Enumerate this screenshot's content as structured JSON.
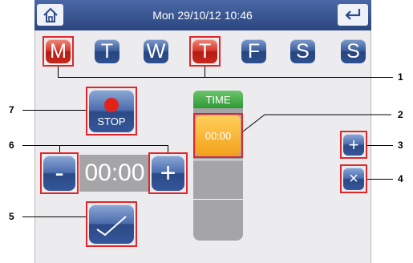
{
  "header": {
    "datetime": "Mon 29/10/12 10:46",
    "home_icon": "home-icon",
    "back_icon": "return-arrow-icon"
  },
  "days": [
    {
      "label": "M",
      "active": true
    },
    {
      "label": "T",
      "active": false
    },
    {
      "label": "W",
      "active": false
    },
    {
      "label": "T",
      "active": true
    },
    {
      "label": "F",
      "active": false
    },
    {
      "label": "S",
      "active": false
    },
    {
      "label": "S",
      "active": false
    }
  ],
  "stop_button": {
    "label": "STOP"
  },
  "time_column": {
    "header": "TIME",
    "slot_value": "00:00"
  },
  "time_adjust": {
    "minus": "-",
    "value": "00:00",
    "plus": "+"
  },
  "side_buttons": {
    "add": "+",
    "delete": "×"
  },
  "callouts": [
    "1",
    "2",
    "3",
    "4",
    "5",
    "6",
    "7"
  ],
  "colors": {
    "header": "#2d4a86",
    "active_day": "#d6362a",
    "highlight_frame": "#e0262a",
    "slot": "#f2a11b",
    "time_header": "#2e9a34"
  }
}
